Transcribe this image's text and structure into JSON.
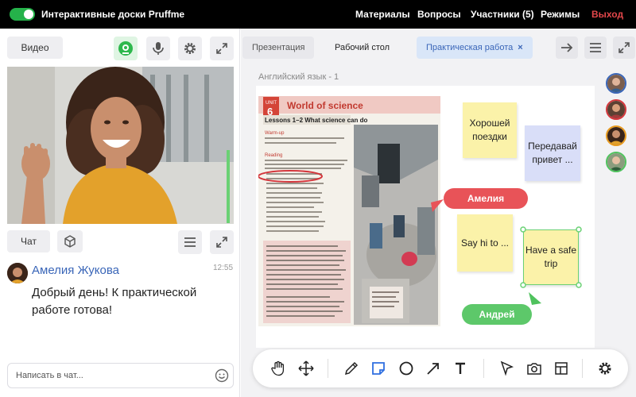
{
  "topbar": {
    "app_title": "Интерактивные доски Pruffme",
    "nav": [
      "Материалы",
      "Вопросы",
      "Участники (5)",
      "Режимы"
    ],
    "exit": "Выход"
  },
  "left": {
    "video_button": "Видео",
    "chat_button": "Чат",
    "chat": {
      "author": "Амелия Жукова",
      "time": "12:55",
      "message": "Добрый день! К практической работе готова!",
      "input_placeholder": "Написать в чат..."
    }
  },
  "right": {
    "tabs": {
      "presentation": "Презентация",
      "desktop": "Рабочий стол",
      "practical": "Практическая работа",
      "practical_close": "×"
    },
    "board_title": "Английский язык - 1",
    "book": {
      "unit_label": "UNIT",
      "unit_number": "6",
      "title": "World of science",
      "subtitle": "Lessons 1–2  What science can do",
      "warmup": "Warm-up",
      "reading": "Reading"
    },
    "stickies": {
      "s1": "Хорошей поездки",
      "s2": "Передавай привет ...",
      "s3": "Say hi to ...",
      "s4": "Have a safe trip"
    },
    "cursors": {
      "amelia": "Амелия",
      "andrey": "Андрей"
    }
  },
  "colors": {
    "accent_blue": "#3a66b8",
    "exit_red": "#e4474b",
    "toggle_green": "#25b24a",
    "sticky_yellow": "#fbf2a9",
    "sticky_blue": "#d9def8",
    "cursor_red": "#e85358",
    "cursor_green": "#5dc86a"
  },
  "icons": {
    "left_controls": [
      "camera-icon",
      "microphone-icon",
      "gear-icon",
      "expand-icon"
    ],
    "chat_controls": [
      "cube-icon",
      "menu-icon",
      "expand-icon"
    ],
    "board_controls": [
      "arrow-right-icon",
      "menu-icon",
      "expand-icon"
    ],
    "tools": [
      "hand-icon",
      "move-icon",
      "pen-icon",
      "sticky-note-icon",
      "circle-icon",
      "arrow-icon",
      "text-icon",
      "pointer-icon",
      "camera-icon",
      "layout-icon",
      "gear-icon"
    ]
  }
}
